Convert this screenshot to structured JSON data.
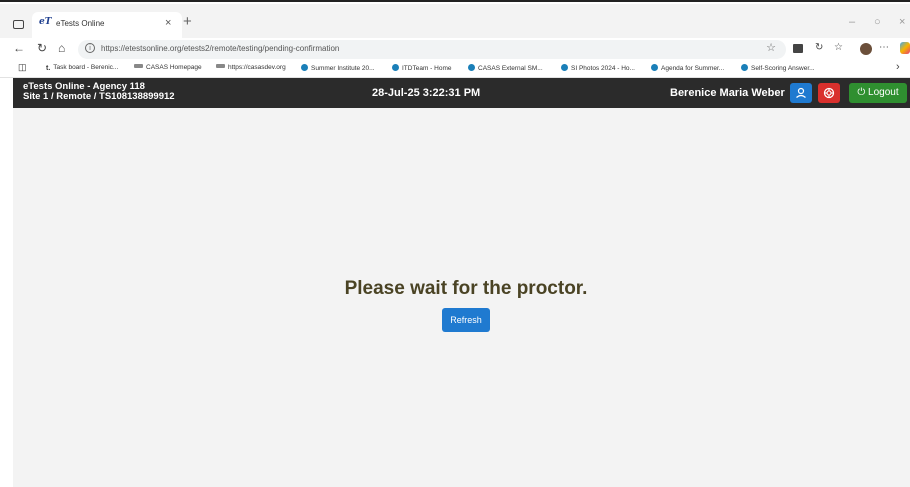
{
  "browser": {
    "tab": {
      "favicon": "eT",
      "title": "eTests Online",
      "close": "×"
    },
    "new_tab": "+",
    "window_controls": [
      "–",
      "○",
      "×"
    ],
    "url": "https://etestsonline.org/etests2/remote/testing/pending-confirmation",
    "bookmarks": [
      {
        "label": "Task board - Berenic..."
      },
      {
        "label": "CASAS Homepage"
      },
      {
        "label": "https://casasdev.org"
      },
      {
        "label": "Summer Institute 20..."
      },
      {
        "label": "ITDTeam - Home"
      },
      {
        "label": "CASAS External SM..."
      },
      {
        "label": "SI Photos 2024 - Ho..."
      },
      {
        "label": "Agenda for Summer..."
      },
      {
        "label": "Self-Scoring Answer..."
      }
    ],
    "bookmark_prefix": "t."
  },
  "header": {
    "agency_line1": "eTests Online - Agency 118",
    "agency_line2": "Site 1 / Remote / TS108138899912",
    "datetime": "28-Jul-25 3:22:31 PM",
    "user_name": "Berenice Maria Weber",
    "logout_label": "Logout"
  },
  "main": {
    "message": "Please wait for the proctor.",
    "refresh_label": "Refresh"
  },
  "colors": {
    "header_bg": "#2b2b2b",
    "primary_blue": "#1f7ad0",
    "danger_red": "#d9302d",
    "success_green": "#2f8f30",
    "message_text": "#4a4324",
    "content_bg": "#f3f3f3"
  },
  "icons": {
    "tab_actions": "tab-actions-icon",
    "back": "back-arrow-icon",
    "reload": "reload-icon",
    "home": "home-icon",
    "site_info": "site-info-icon",
    "favorite": "star-icon",
    "user": "user-icon",
    "help": "lifebuoy-icon",
    "logout": "power-icon"
  }
}
